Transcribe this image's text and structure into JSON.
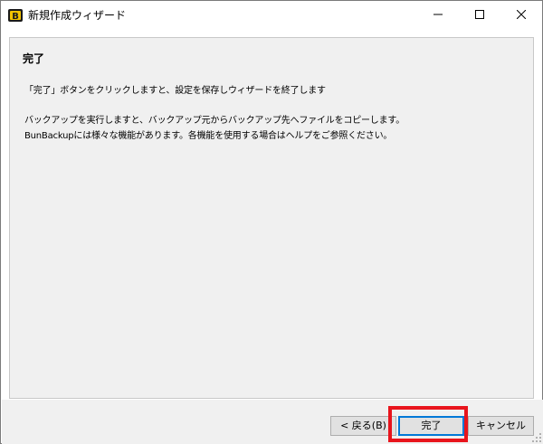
{
  "window": {
    "title": "新規作成ウィザード",
    "icon": "bunbackup-app-icon",
    "controls": [
      "minimize-icon",
      "maximize-icon",
      "close-icon"
    ]
  },
  "page": {
    "heading": "完了",
    "instruction": "「完了」ボタンをクリックしますと、設定を保存しウィザードを終了します",
    "description_1": "バックアップを実行しますと、バックアップ元からバックアップ先へファイルをコピーします。",
    "description_2": "BunBackupには様々な機能があります。各機能を使用する場合はヘルプをご参照ください。"
  },
  "buttons": {
    "back": "< 戻る(B)",
    "finish": "完了",
    "cancel": "キャンセル"
  },
  "colors": {
    "highlight": "#e8141c",
    "focus": "#0078d7",
    "panel": "#f0f0f0"
  }
}
